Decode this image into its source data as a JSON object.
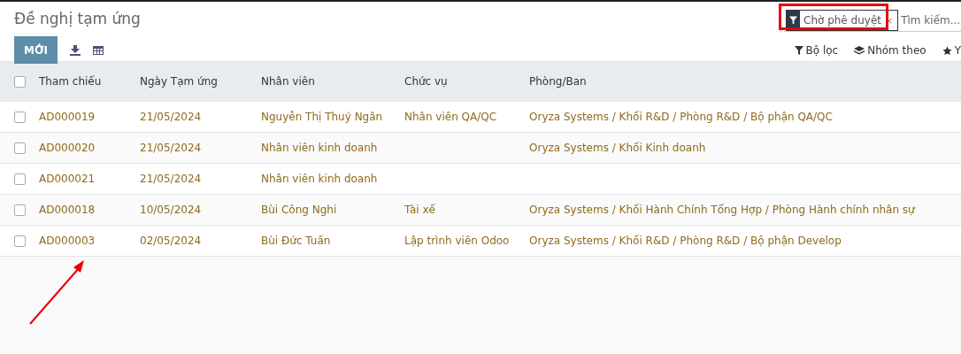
{
  "title": "Đề nghị tạm ứng",
  "toolbar": {
    "new_button": "MỚI"
  },
  "search": {
    "facet": "Chờ phê duyệt",
    "facet_remove": "×",
    "placeholder": "Tìm kiếm..."
  },
  "search_options": [
    {
      "label": "Bộ lọc",
      "kind": "filter"
    },
    {
      "label": "Nhóm theo",
      "kind": "group"
    },
    {
      "label": "Y",
      "kind": "favorite"
    }
  ],
  "table": {
    "select_all": {
      "checked": false
    },
    "columns": [
      "Tham chiếu",
      "Ngày Tạm ứng",
      "Nhân viên",
      "Chức vụ",
      "Phòng/Ban"
    ],
    "rows": [
      {
        "checked": false,
        "cells": [
          "AD000019",
          "21/05/2024",
          "Nguyễn Thị Thuý Ngân",
          "Nhân viên QA/QC",
          "Oryza Systems / Khối R&D / Phòng R&D / Bộ phận QA/QC"
        ]
      },
      {
        "checked": false,
        "cells": [
          "AD000020",
          "21/05/2024",
          "Nhân viên kinh doanh",
          "",
          "Oryza Systems / Khối Kinh doanh"
        ]
      },
      {
        "checked": false,
        "cells": [
          "AD000021",
          "21/05/2024",
          "Nhân viên kinh doanh",
          "",
          ""
        ]
      },
      {
        "checked": false,
        "cells": [
          "AD000018",
          "10/05/2024",
          "Bùi Công Nghi",
          "Tài xế",
          "Oryza Systems / Khối Hành Chính Tổng Hợp / Phòng Hành chính nhân sự"
        ]
      },
      {
        "checked": false,
        "cells": [
          "AD000003",
          "02/05/2024",
          "Bùi Đức Tuấn",
          "Lập trình viên Odoo",
          "Oryza Systems / Khối R&D / Phòng R&D / Bộ phận Develop"
        ]
      }
    ]
  }
}
